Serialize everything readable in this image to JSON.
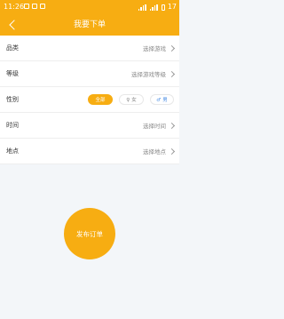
{
  "status_bar": {
    "time": "11:26",
    "battery": "17"
  },
  "header": {
    "title": "我要下单"
  },
  "rows": {
    "category": {
      "label": "品类",
      "value": "选择游戏"
    },
    "level": {
      "label": "等级",
      "value": "选择游戏等级"
    },
    "gender": {
      "label": "性别",
      "options": [
        {
          "label": "全部",
          "selected": true
        },
        {
          "symbol": "♀",
          "label": "女",
          "selected": false
        },
        {
          "symbol": "♂",
          "label": "男",
          "selected": false
        }
      ]
    },
    "time": {
      "label": "时间",
      "value": "选择时间"
    },
    "location": {
      "label": "地点",
      "value": "选择地点"
    }
  },
  "publish_button": {
    "label": "发布订单"
  },
  "colors": {
    "accent": "#f7ad12",
    "male": "#4a8de3",
    "background": "#f3f6f9"
  },
  "icons": [
    "back-arrow-icon",
    "chevron-right-icon",
    "female-icon",
    "male-icon"
  ]
}
